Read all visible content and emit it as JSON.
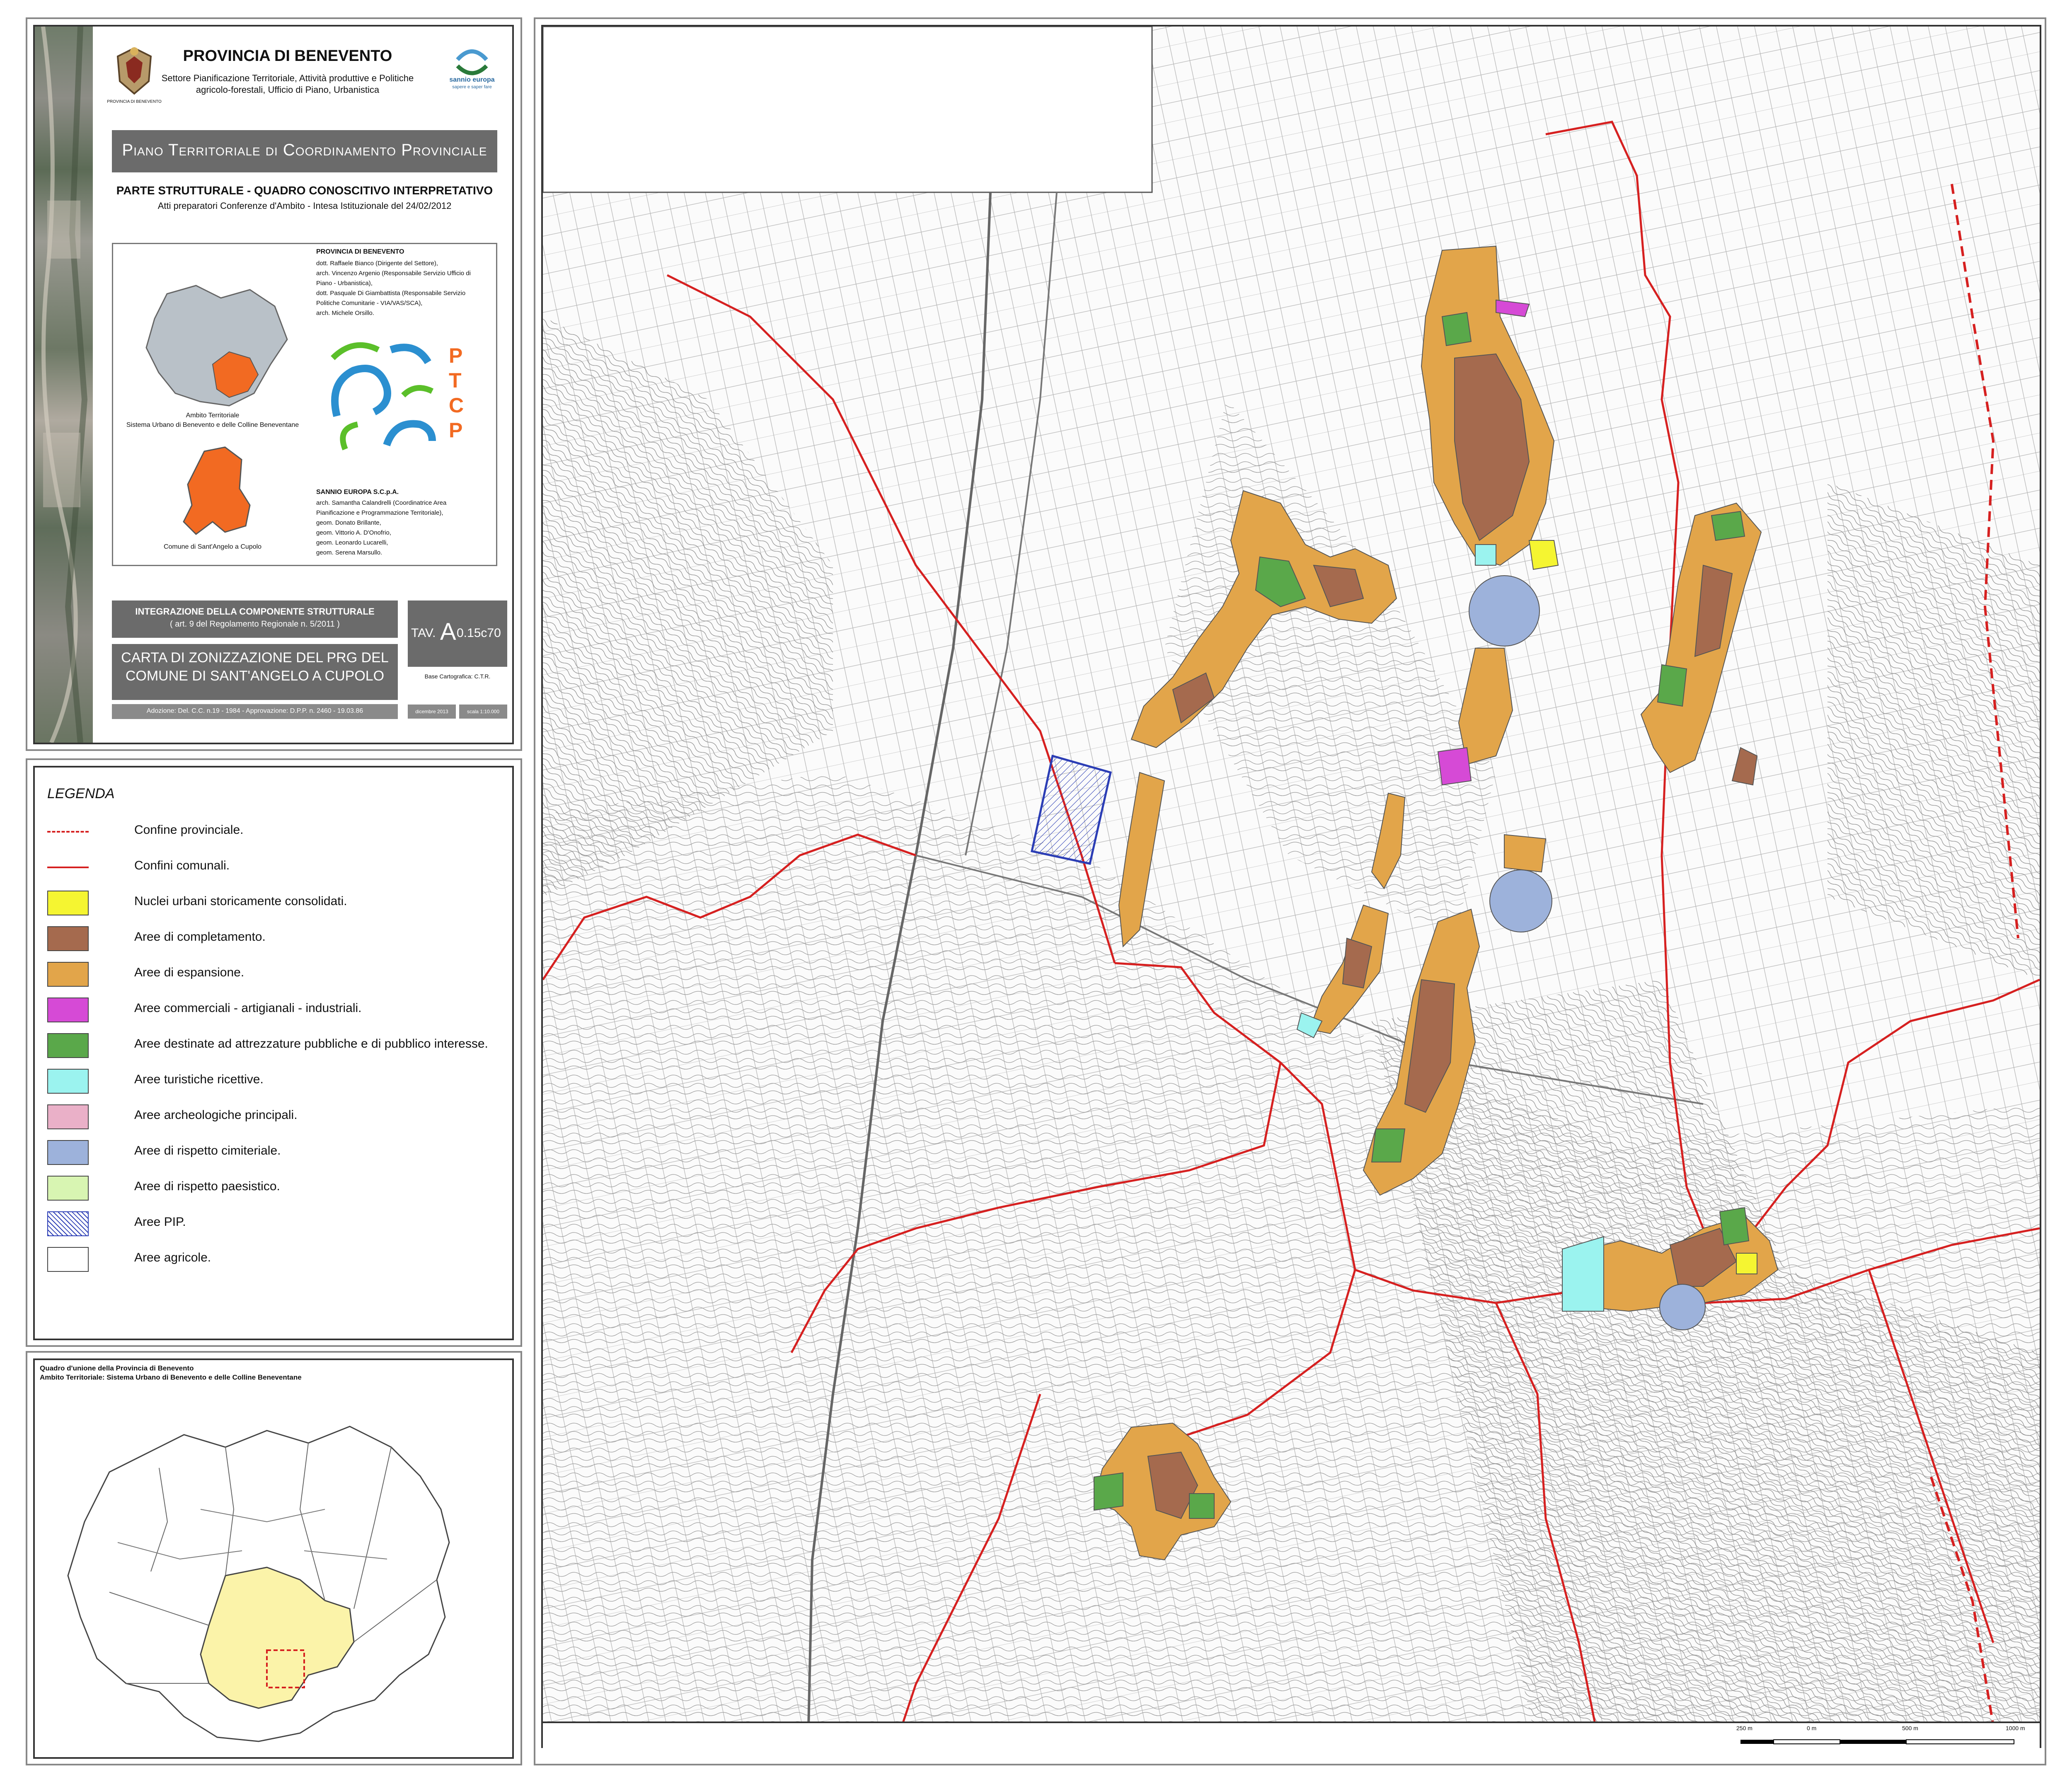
{
  "header": {
    "province": "PROVINCIA DI BENEVENTO",
    "sector_line1": "Settore Pianificazione Territoriale, Attività produttive e Politiche",
    "sector_line2": "agricolo-forestali, Ufficio di Piano, Urbanistica",
    "logo_caption": "PROVINCIA DI BENEVENTO",
    "sannio_logo_text": "sannio europa",
    "sannio_logo_sub": "sapere e saper fare",
    "ptcp_title": "Piano Territoriale di Coordinamento Provinciale",
    "part_title": "PARTE STRUTTURALE - QUADRO CONOSCITIVO INTERPRETATIVO",
    "acts": "Atti preparatori Conferenze d'Ambito - Intesa Istituzionale del 24/02/2012"
  },
  "credits": {
    "province_title": "PROVINCIA DI BENEVENTO",
    "province_lines": [
      "dott. Raffaele Bianco (Dirigente del Settore),",
      "arch. Vincenzo Argenio (Responsabile Servizio Ufficio di",
      "Piano - Urbanistica),",
      "dott. Pasquale Di Giambattista (Responsabile Servizio",
      "Politiche Comunitarie - VIA/VAS/SCA),",
      "arch. Michele Orsillo."
    ],
    "ambito_caption_1": "Ambito Territoriale",
    "ambito_caption_2": "Sistema Urbano di Benevento e delle Colline Beneventane",
    "comune_caption": "Comune di Sant'Angelo a Cupolo",
    "ptcp_letters": [
      "P",
      "T",
      "C",
      "P"
    ],
    "sannio_title": "SANNIO EUROPA S.C.p.A.",
    "sannio_lines": [
      "arch. Samantha Calandrelli (Coordinatrice Area",
      "Pianificazione e Programmazione Territoriale),",
      "geom. Donato Brillante,",
      "geom. Vittorio A. D'Onofrio,",
      "geom. Leonardo Lucarelli,",
      "geom. Serena Marsullo."
    ]
  },
  "title_block": {
    "integr_line1": "INTEGRAZIONE DELLA COMPONENTE STRUTTURALE",
    "integr_line2": "( art. 9 del Regolamento Regionale n. 5/2011 )",
    "tav_label": "TAV.",
    "tav_big": "A",
    "tav_num": "0.15c70",
    "map_title_1": "CARTA DI ZONIZZAZIONE DEL PRG DEL",
    "map_title_2": "COMUNE DI SANT'ANGELO A CUPOLO",
    "base": "Base Cartografica: C.T.R.",
    "adoption": "Adozione: Del. C.C. n.19 - 1984 - Approvazione: D.P.P. n. 2460 - 19.03.86",
    "date": "dicembre 2013",
    "scale": "scala 1:10.000"
  },
  "legend": {
    "title": "LEGENDA",
    "items": [
      {
        "label": "Confine provinciale.",
        "kind": "dashed",
        "color": "#d62020"
      },
      {
        "label": "Confini comunali.",
        "kind": "line",
        "color": "#d62020"
      },
      {
        "label": "Nuclei urbani storicamente consolidati.",
        "kind": "fill",
        "color": "#f5f531"
      },
      {
        "label": "Aree di completamento.",
        "kind": "fill",
        "color": "#a56a4e"
      },
      {
        "label": "Aree di espansione.",
        "kind": "fill",
        "color": "#e2a54a"
      },
      {
        "label": "Aree commerciali - artigianali - industriali.",
        "kind": "fill",
        "color": "#d64ad6"
      },
      {
        "label": "Aree destinate ad attrezzature pubbliche e di pubblico interesse.",
        "kind": "fill",
        "color": "#5aa84a"
      },
      {
        "label": "Aree turistiche ricettive.",
        "kind": "fill",
        "color": "#9bf3ef"
      },
      {
        "label": "Aree archeologiche principali.",
        "kind": "fill",
        "color": "#eab0c8"
      },
      {
        "label": "Aree di rispetto cimiteriale.",
        "kind": "fill",
        "color": "#9db2db"
      },
      {
        "label": "Aree di rispetto paesistico.",
        "kind": "fill",
        "color": "#d8f5b2"
      },
      {
        "label": "Aree PIP.",
        "kind": "hatch",
        "color": "#2b3db5"
      },
      {
        "label": "Aree agricole.",
        "kind": "fill",
        "color": "#ffffff"
      }
    ]
  },
  "overview": {
    "title_1": "Quadro d'unione della Provincia di Benevento",
    "title_2": "Ambito Territoriale: Sistema Urbano di Benevento e delle Colline Beneventane"
  },
  "scalebar": {
    "labels": [
      "250 m",
      "0 m",
      "500 m",
      "1000 m"
    ]
  }
}
